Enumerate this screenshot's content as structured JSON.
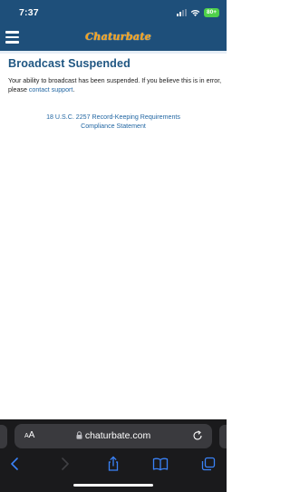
{
  "status_bar": {
    "time": "7:37",
    "battery": "80+",
    "icons": [
      "signal-icon",
      "wifi-icon",
      "battery-icon"
    ]
  },
  "header": {
    "logo_text": "Chaturbate",
    "menu_icon": "hamburger-icon"
  },
  "main": {
    "title": "Broadcast Suspended",
    "message_before_link": "Your ability to broadcast has been suspended. If you believe this is in error, please ",
    "link_text": "contact support",
    "message_after_link": "."
  },
  "footer": {
    "links": [
      "18 U.S.C. 2257 Record-Keeping Requirements",
      "Compliance Statement"
    ]
  },
  "browser": {
    "text_size_label_small": "A",
    "text_size_label_large": "A",
    "url": "chaturbate.com",
    "toolbar_icons": [
      "back-icon",
      "forward-icon",
      "share-icon",
      "bookmarks-icon",
      "tabs-icon"
    ]
  },
  "colors": {
    "header_bg": "#1e4f7a",
    "title": "#1f5682",
    "link": "#2367a3",
    "logo": "#f7a21b",
    "browser_bg": "#1a1a1c"
  }
}
